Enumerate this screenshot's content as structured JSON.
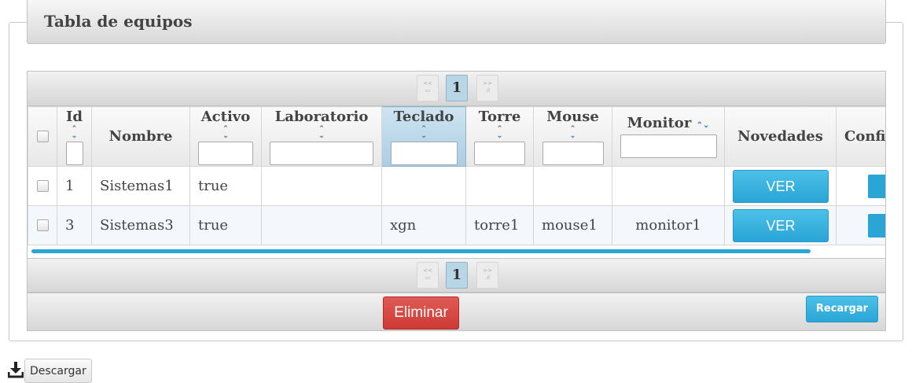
{
  "panel": {
    "title": "Tabla de equipos"
  },
  "pager": {
    "first_label": "<<",
    "prev_label": "▭",
    "next_label": ">>",
    "last_label": ".ıl",
    "current_page": "1"
  },
  "table": {
    "columns": [
      {
        "key": "select",
        "label": ""
      },
      {
        "key": "id",
        "label": "Id",
        "sortable": true,
        "filter": ""
      },
      {
        "key": "nombre",
        "label": "Nombre"
      },
      {
        "key": "activo",
        "label": "Activo",
        "sortable": true,
        "filter": ""
      },
      {
        "key": "laboratorio",
        "label": "Laboratorio",
        "sortable": true,
        "filter": ""
      },
      {
        "key": "teclado",
        "label": "Teclado",
        "sortable": true,
        "filter": "",
        "selected": true
      },
      {
        "key": "torre",
        "label": "Torre",
        "sortable": true,
        "filter": ""
      },
      {
        "key": "mouse",
        "label": "Mouse",
        "sortable": true,
        "filter": ""
      },
      {
        "key": "monitor",
        "label": "Monitor",
        "sortable": true,
        "filter": ""
      },
      {
        "key": "novedades",
        "label": "Novedades"
      },
      {
        "key": "config",
        "label": "Confi"
      }
    ],
    "rows": [
      {
        "id": "1",
        "nombre": "Sistemas1",
        "activo": "true",
        "laboratorio": "",
        "teclado": "",
        "torre": "",
        "mouse": "",
        "monitor": "",
        "novedades": "VER"
      },
      {
        "id": "3",
        "nombre": "Sistemas3",
        "activo": "true",
        "laboratorio": "",
        "teclado": "xgn",
        "torre": "torre1",
        "mouse": "mouse1",
        "monitor": "monitor1",
        "novedades": "VER"
      }
    ]
  },
  "footer": {
    "delete_label": "Eliminar",
    "reload_label": "Recargar"
  },
  "download": {
    "label": "Descargar",
    "icon": "download-icon"
  },
  "colors": {
    "accent": "#2aa5d6",
    "danger": "#cc3a35",
    "selected_header": "#b9d6e6"
  }
}
